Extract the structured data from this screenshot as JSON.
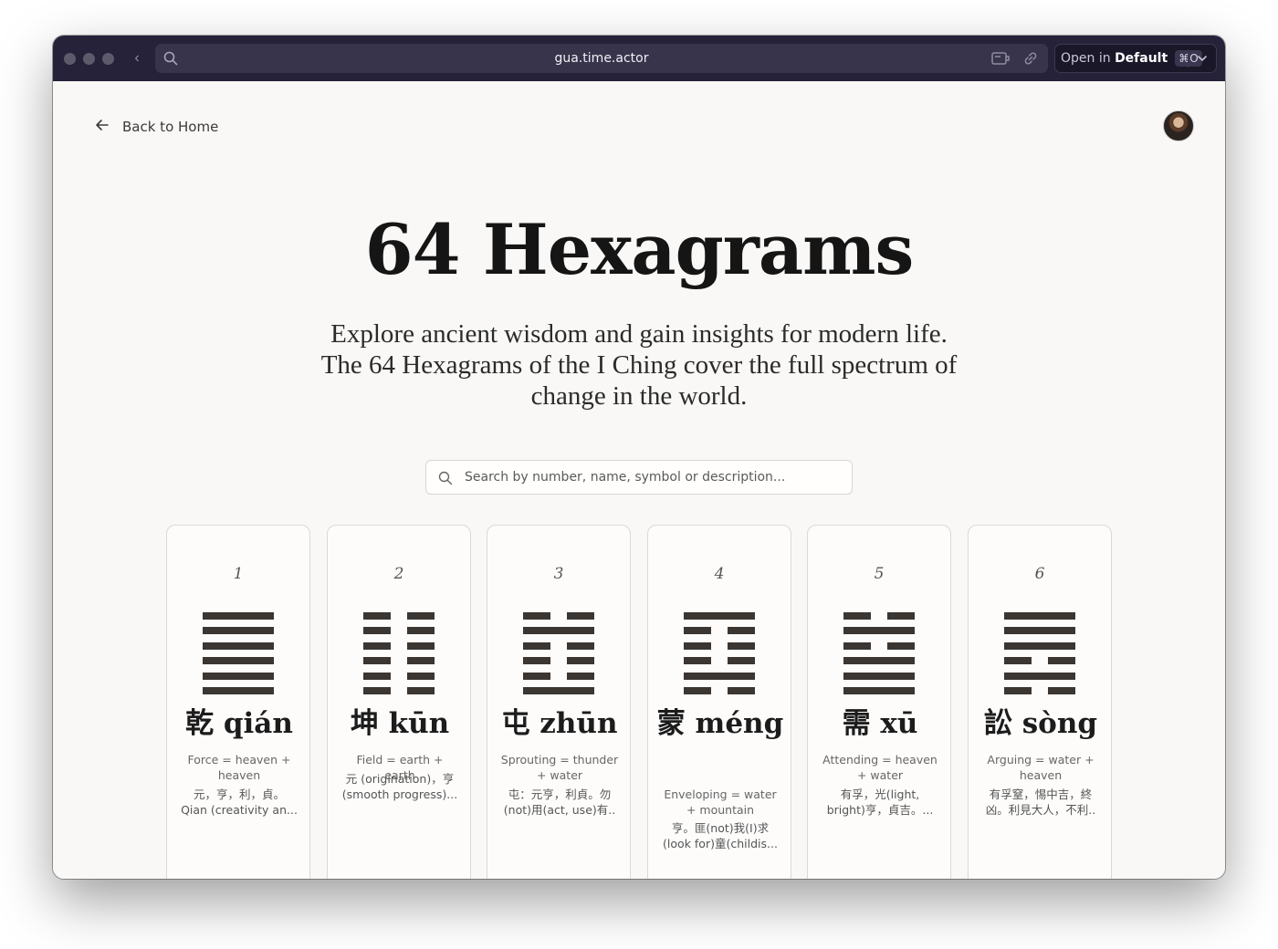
{
  "browser": {
    "url": "gua.time.actor",
    "open_prefix": "Open in",
    "open_default": "Default",
    "open_shortcut": "⌘O"
  },
  "nav": {
    "back_label": "Back to Home"
  },
  "page": {
    "title": "64 Hexagrams",
    "subtitle": "Explore ancient wisdom and gain insights for modern life. The 64 Hexagrams of the I Ching cover the full spectrum of change in the world."
  },
  "search": {
    "placeholder": "Search by number, name, symbol or description..."
  },
  "colors": {
    "line": "#3b3632",
    "titlebar": "#25223a",
    "page_bg": "#f9f8f6"
  },
  "cards": [
    {
      "number": "1",
      "name": "乾 qián",
      "meaning": "Force = heaven + heaven",
      "desc1": "元，亨，利，貞。",
      "desc2": "Qian (creativity an...",
      "lines_bottom_to_top": [
        1,
        1,
        1,
        1,
        1,
        1
      ]
    },
    {
      "number": "2",
      "name": "坤 kūn",
      "meaning": "Field = earth + earth",
      "desc1": "元 (origination)，亨",
      "desc2": "(smooth progress)...",
      "lines_bottom_to_top": [
        0,
        0,
        0,
        0,
        0,
        0
      ]
    },
    {
      "number": "3",
      "name": "屯 zhūn",
      "meaning": "Sprouting = thunder + water",
      "desc1": "屯：元亨，利貞。勿",
      "desc2": "(not)用(act, use)有..",
      "lines_bottom_to_top": [
        1,
        0,
        0,
        0,
        1,
        0
      ]
    },
    {
      "number": "4",
      "name": "蒙 méng",
      "meaning": "Enveloping = water + mountain",
      "desc1": "亨。匪(not)我(I)求",
      "desc2": "(look for)童(childis...",
      "lines_bottom_to_top": [
        0,
        1,
        0,
        0,
        0,
        1
      ]
    },
    {
      "number": "5",
      "name": "需 xū",
      "meaning": "Attending = heaven + water",
      "desc1": "有孚，光(light,",
      "desc2": "bright)亨，貞吉。...",
      "lines_bottom_to_top": [
        1,
        1,
        1,
        0,
        1,
        0
      ]
    },
    {
      "number": "6",
      "name": "訟 sòng",
      "meaning": "Arguing = water + heaven",
      "desc1": "有孚窒，惕中吉，終",
      "desc2": "凶。利見大人，不利..",
      "lines_bottom_to_top": [
        0,
        1,
        0,
        1,
        1,
        1
      ]
    }
  ]
}
